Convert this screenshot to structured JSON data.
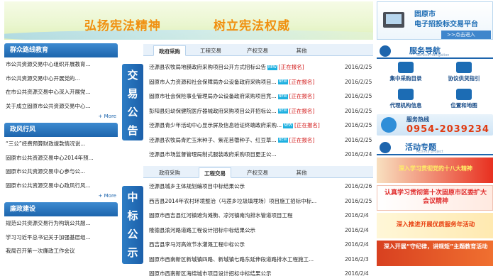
{
  "banner": {
    "slogan_left": "弘扬宪法精神",
    "slogan_right": "树立宪法权威"
  },
  "portal": {
    "line1": "固原市",
    "line2": "电子招投标交易平台",
    "enter": ">>点击进入"
  },
  "left": {
    "sections": [
      {
        "title": "群众路线教育",
        "items": [
          "市公共资源交易中心组织开展教育...",
          "市公共资源交易中心开展党的...",
          "在市公共资源交易中心深入开展党...",
          "关于成立固原市公共资源交易中心..."
        ],
        "more": "+ More"
      },
      {
        "title": "政风行风",
        "items": [
          "“三公”经费预算财政拨款情况说...",
          "固原市公共资源交易中心2014年预...",
          "固原市公共资源交易中心参与公...",
          "固原市公共资源交易中心政风行风..."
        ],
        "more": "+ More"
      },
      {
        "title": "廉政建设",
        "items": [
          "规范公共资源交易行为构筑公共服...",
          "学习习近平总书记关于加强基层组...",
          "我局召开第一次廉政工作会议"
        ]
      }
    ]
  },
  "notice": {
    "label": [
      "交",
      "易",
      "公",
      "告"
    ],
    "tabs": [
      "政府采购",
      "工程交易",
      "产权交易",
      "其他"
    ],
    "active_tab": 0,
    "rows": [
      {
        "title": "泾源县农牧局地膜政府采购项目公开方式招标公告",
        "status": "[正在报名]",
        "date": "2016/2/25"
      },
      {
        "title": "固原市人力资源和社会保障局办公设备政府采购项目...",
        "status": "[正在报名]",
        "date": "2016/2/25"
      },
      {
        "title": "固原市社会保险事业管理局办公设备政府采购项目竞...",
        "status": "[正在报名]",
        "date": "2016/2/25"
      },
      {
        "title": "彭阳县妇幼保健院医疗器械政府采购项目公开招标公...",
        "status": "[正在报名]",
        "date": "2016/2/25"
      },
      {
        "title": "泾源县青少年活动中心显示屏及信息验证终端政府采购...",
        "status": "[正在报名]",
        "date": "2016/2/25"
      },
      {
        "title": "泾源县农牧局青贮玉米种子、紫花苜蓿种子、红豆草...",
        "status": "[正在报名]",
        "date": "2016/2/25"
      },
      {
        "title": "泾源县市场监督管理局制式服装政府采购项目更正公...",
        "status": "",
        "date": "2016/2/24"
      }
    ]
  },
  "award": {
    "label": [
      "中",
      "标",
      "公",
      "示"
    ],
    "tabs": [
      "政府采购",
      "工程交易",
      "产权交易",
      "其他"
    ],
    "active_tab": 1,
    "rows": [
      {
        "title": "泾源县城乡主体规划编项目中标结果公示",
        "date": "2016/2/26"
      },
      {
        "title": "西吉县2014年农村环境整治（马莲乡垃圾填埋场）项目施工招标中标...",
        "date": "2016/2/25"
      },
      {
        "title": "固原市西吉县红河镇遮沟滩衡、凉河镇南沟排水管道项目工程",
        "date": "2016/2/4"
      },
      {
        "title": "隆德县渝河路道路工程设计招标中标结果公示",
        "date": "2016/2/4"
      },
      {
        "title": "西吉县李马河高效节水灌溉工程中标公示",
        "date": "2016/2/4"
      },
      {
        "title": "固原市西南新区新城镇四路、新城镇七路东延伸段道路排水工程施工...",
        "date": "2016/2/3"
      },
      {
        "title": "固原市西南新区海绵城市项目设计招标中标结果公示",
        "date": "2016/2/4"
      }
    ]
  },
  "service_nav": {
    "title": "服务导航",
    "subtitle": "Service navigation",
    "items": [
      {
        "label": "集中采购目录",
        "icon": "folder-icon"
      },
      {
        "label": "协议供货指引",
        "icon": "handshake-icon"
      },
      {
        "label": "代理机构信息",
        "icon": "people-icon"
      },
      {
        "label": "位置和地图",
        "icon": "map-pin-icon"
      }
    ]
  },
  "hotline": {
    "label": "服务热线",
    "sub": "SERVICE HOTLINE",
    "number": "0954-2039234"
  },
  "activities": {
    "title": "活动专题",
    "subtitle": "Activity project",
    "banners": [
      "深入学习贯彻党的十八大精神",
      "认真学习贯彻第十次固原市区委扩大会议精神",
      "深入推进开展优质服务年活动",
      "深入开展“守纪律，讲规矩”主题教育活动"
    ]
  },
  "colors": {
    "primary_blue": "#1d65ad",
    "slogan_orange": "#f09010",
    "status_red": "#d01010",
    "hotline_red": "#e03a10"
  }
}
